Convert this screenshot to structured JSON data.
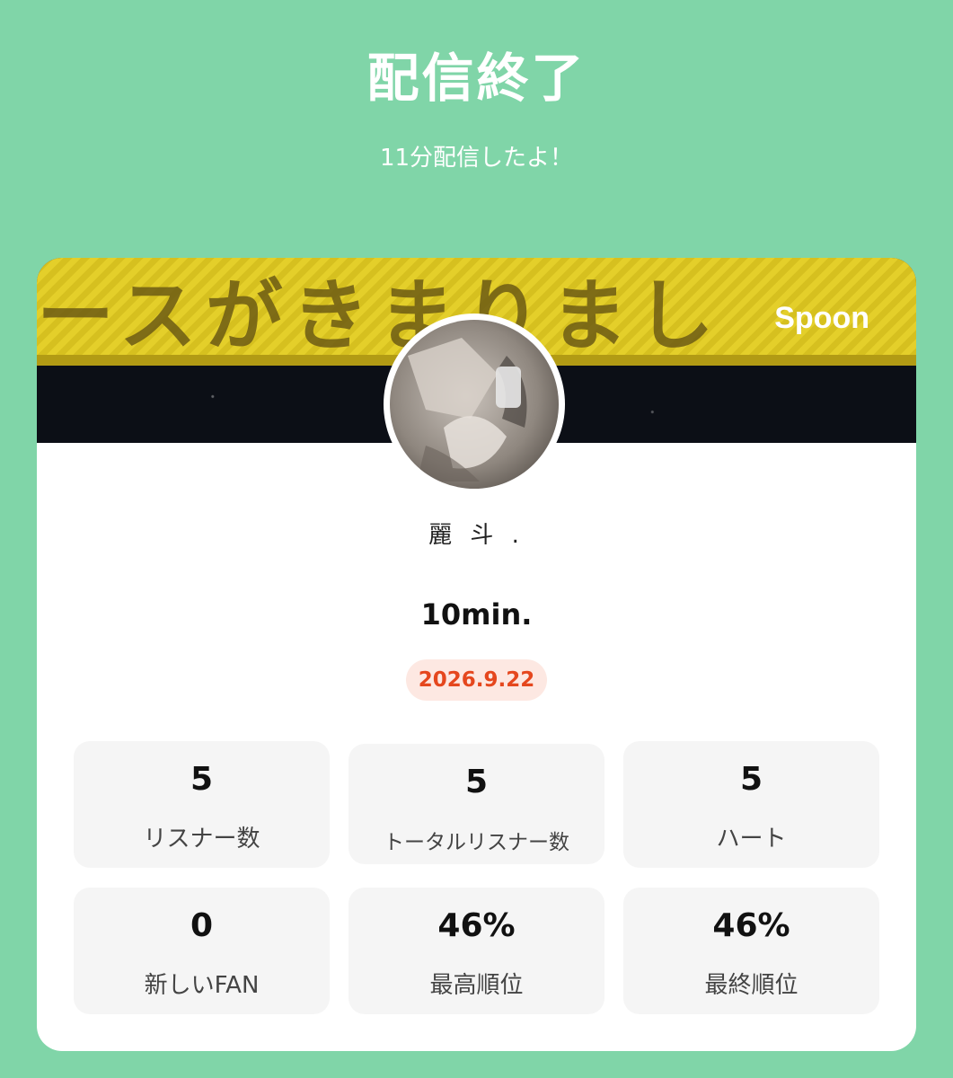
{
  "header": {
    "title": "配信終了",
    "subtitle": "11分配信したよ！"
  },
  "card": {
    "banner_text": "ースがきまりまし",
    "logo": "Spoon",
    "username": "麗 斗 .",
    "duration": "10min.",
    "date": "2026.9.22",
    "stats": [
      {
        "value": "5",
        "label": "リスナー数"
      },
      {
        "value": "5",
        "label": "トータルリスナー数"
      },
      {
        "value": "5",
        "label": "ハート"
      },
      {
        "value": "0",
        "label": "新しいFAN"
      },
      {
        "value": "46%",
        "label": "最高順位"
      },
      {
        "value": "46%",
        "label": "最終順位"
      }
    ]
  },
  "colors": {
    "background": "#80D5A8",
    "date_text": "#E5471E",
    "date_badge_bg": "#FDE8E2",
    "stat_bg": "#F5F5F5"
  }
}
